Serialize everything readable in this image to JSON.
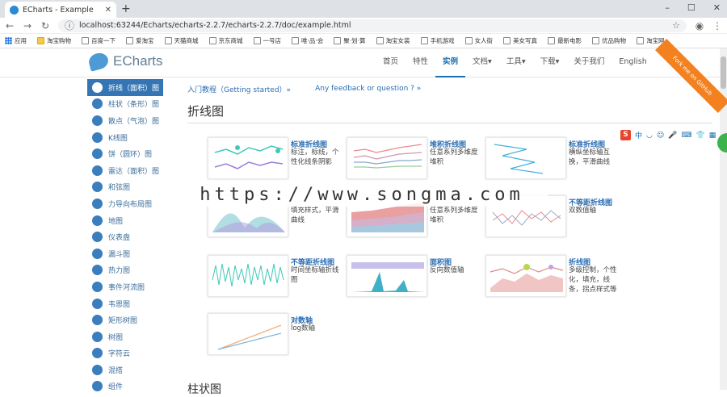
{
  "browser": {
    "tab_title": "ECharts - Example",
    "url": "localhost:63244/Echarts/echarts-2.2.7/echarts-2.2.7/doc/example.html",
    "bookmarks": [
      "应用",
      "淘宝购物",
      "百度一下",
      "爱淘宝",
      "天猫商城",
      "京东商城",
      "一号店",
      "唯·品·会",
      "聚·划·算",
      "淘宝女装",
      "手机游戏",
      "女人街",
      "美女写真",
      "最新电影",
      "优品购物",
      "淘宝网"
    ]
  },
  "header": {
    "logo_text": "ECharts",
    "nav": [
      "首页",
      "特性",
      "实例",
      "文档▾",
      "工具▾",
      "下载▾",
      "关于我们",
      "English"
    ],
    "active_nav": "实例",
    "ribbon": "Fork me on GitHub"
  },
  "sidebar": {
    "items": [
      "折线（面积）图",
      "柱状（条形）图",
      "散点（气泡）图",
      "K线图",
      "饼（圆环）图",
      "雷达（面积）图",
      "和弦图",
      "力导向布局图",
      "地图",
      "仪表盘",
      "漏斗图",
      "热力图",
      "事件河流图",
      "韦恩图",
      "矩形树图",
      "树图",
      "字符云",
      "混搭",
      "组件"
    ]
  },
  "main": {
    "link_getting_started": "入门教程（Getting started）»",
    "link_feedback": "Any feedback or question ? »",
    "section_title": "折线图",
    "next_section_title": "柱状图",
    "cards": [
      {
        "title": "标准折线图",
        "desc": "标注，标线，个性化线条阴影"
      },
      {
        "title": "堆积折线图",
        "desc": "任意系列多维度堆积"
      },
      {
        "title": "标准折线图",
        "desc": "横纵坐标轴互换，平滑曲线"
      },
      {
        "title": "",
        "desc": "填充样式，平滑曲线"
      },
      {
        "title": "",
        "desc": "任意系列多维度堆积"
      },
      {
        "title": "不等距折线图",
        "desc": "双数值轴"
      },
      {
        "title": "不等距折线图",
        "desc": "时间坐标轴折线图"
      },
      {
        "title": "面积图",
        "desc": "反向数值轴"
      },
      {
        "title": "折线图",
        "desc": "多级控制，个性化，填充，线条，拐点样式等"
      },
      {
        "title": "对数轴",
        "desc": "log数轴"
      }
    ]
  },
  "watermark": "https://www.songma.com",
  "ime": {
    "logo": "S",
    "lang": "中"
  }
}
